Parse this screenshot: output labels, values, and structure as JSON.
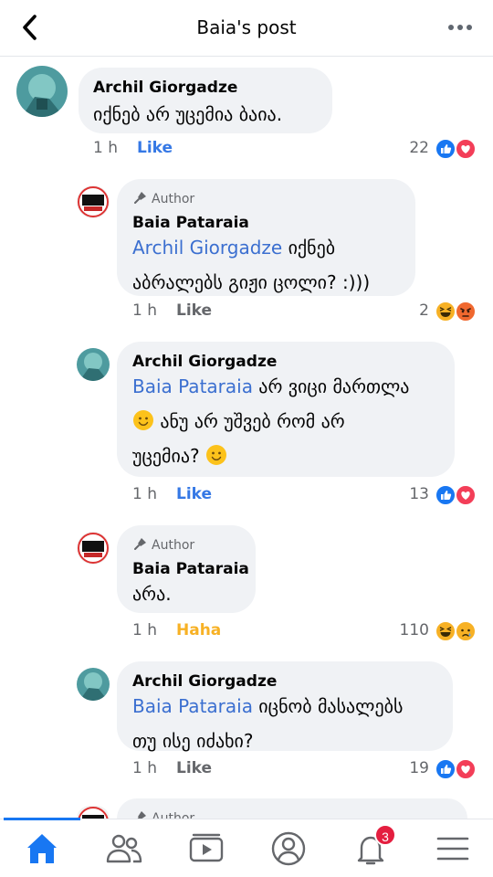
{
  "header": {
    "title": "Baia's post"
  },
  "comments": [
    {
      "name": "Archil Giorgadze",
      "text": "იქნებ არ უცემია ბაია.",
      "time": "1 h",
      "like": "Like",
      "count": "22"
    },
    {
      "author": "Author",
      "name": "Baia Pataraia",
      "mention": "Archil Giorgadze",
      "text_a": " იქნებ",
      "text_b": "აბრალებს გიჟი ცოლი? :)))",
      "time": "1 h",
      "like": "Like",
      "count": "2"
    },
    {
      "name": "Archil Giorgadze",
      "mention": "Baia Pataraia",
      "text_a": "  არ ვიცი მართლა",
      "text_b": " ანუ არ უშვებ რომ არ",
      "text_c": "უცემია? ",
      "time": "1 h",
      "like": "Like",
      "count": "13"
    },
    {
      "author": "Author",
      "name": "Baia Pataraia",
      "text": "არა.",
      "time": "1 h",
      "like": "Haha",
      "count": "110"
    },
    {
      "name": "Archil Giorgadze",
      "mention": "Baia Pataraia",
      "text_a": "  იცნობ მასალებს",
      "text_b": "თუ ისე იძახი?",
      "time": "1 h",
      "like": "Like",
      "count": "19"
    },
    {
      "author": "Author"
    }
  ],
  "nav": {
    "notifications_badge": "3",
    "items": [
      "home-icon",
      "friends-icon",
      "watch-icon",
      "profile-icon",
      "bell-icon",
      "menu-icon"
    ]
  },
  "colors": {
    "accent": "#1877f2",
    "mention": "#3b6fd0",
    "bubble": "#f0f2f5",
    "haha": "#f7b125"
  }
}
